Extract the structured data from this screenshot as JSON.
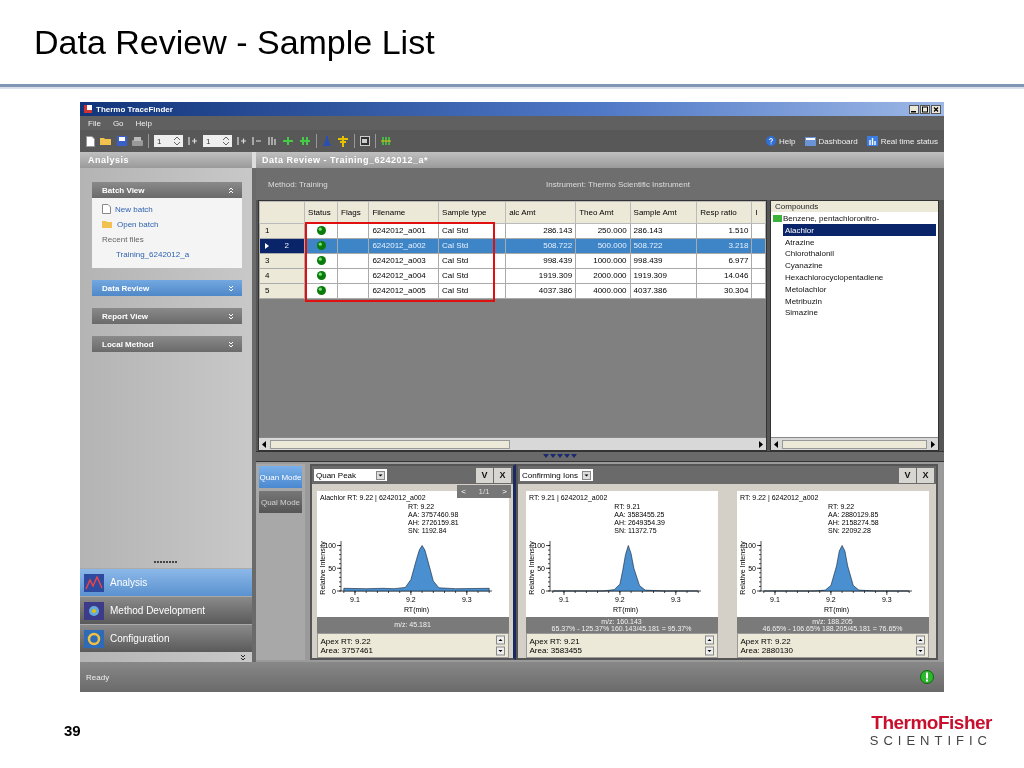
{
  "slide": {
    "title": "Data Review - Sample List",
    "page_number": "39",
    "logo": {
      "name": "ThermoFisher",
      "tagline": "SCIENTIFIC"
    }
  },
  "window": {
    "title": "Thermo TraceFinder"
  },
  "menu": [
    "File",
    "Go",
    "Help"
  ],
  "toolbar": {
    "spinners": [
      "1",
      "1"
    ],
    "links": [
      "Help",
      "Dashboard",
      "Real time status"
    ]
  },
  "sidebar": {
    "title": "Analysis",
    "panels": [
      {
        "title": "Batch View",
        "selected": false,
        "expanded": true,
        "items": [
          {
            "kind": "doc-link",
            "label": "New batch"
          },
          {
            "kind": "folder-link",
            "label": "Open batch"
          },
          {
            "kind": "heading",
            "label": "Recent files"
          },
          {
            "kind": "recent",
            "label": "Training_6242012_a"
          }
        ]
      },
      {
        "title": "Data Review",
        "selected": true,
        "expanded": false
      },
      {
        "title": "Report View",
        "selected": false,
        "expanded": false
      },
      {
        "title": "Local Method",
        "selected": false,
        "expanded": false
      }
    ],
    "nav": [
      {
        "label": "Analysis",
        "selected": true
      },
      {
        "label": "Method Development",
        "selected": false
      },
      {
        "label": "Configuration",
        "selected": false
      }
    ]
  },
  "main": {
    "title": "Data Review - Training_6242012_a*",
    "method": "Method:  Training",
    "instrument": "Instrument:  Thermo Scientific Instrument"
  },
  "table": {
    "columns": [
      "Status",
      "Flags",
      "Filename",
      "Sample type",
      "alc Amt",
      "Theo Amt",
      "Sample Amt",
      "Resp ratio",
      "I"
    ],
    "rows": [
      {
        "number": "1",
        "selected": false,
        "filename": "6242012_a001",
        "sample_type": "Cal Std",
        "calc_amt": "286.143",
        "theo_amt": "250.000",
        "sample_amt": "286.143",
        "resp_ratio": "1.510"
      },
      {
        "number": "2",
        "selected": true,
        "filename": "6242012_a002",
        "sample_type": "Cal Std",
        "calc_amt": "508.722",
        "theo_amt": "500.000",
        "sample_amt": "508.722",
        "resp_ratio": "3.218"
      },
      {
        "number": "3",
        "selected": false,
        "filename": "6242012_a003",
        "sample_type": "Cal Std",
        "calc_amt": "998.439",
        "theo_amt": "1000.000",
        "sample_amt": "998.439",
        "resp_ratio": "6.977"
      },
      {
        "number": "4",
        "selected": false,
        "filename": "6242012_a004",
        "sample_type": "Cal Std",
        "calc_amt": "1919.309",
        "theo_amt": "2000.000",
        "sample_amt": "1919.309",
        "resp_ratio": "14.046"
      },
      {
        "number": "5",
        "selected": false,
        "filename": "6242012_a005",
        "sample_type": "Cal Std",
        "calc_amt": "4037.386",
        "theo_amt": "4000.000",
        "sample_amt": "4037.386",
        "resp_ratio": "30.304"
      }
    ]
  },
  "compounds": {
    "title": "Compounds",
    "tree": [
      {
        "label": "Benzene, pentachloronitro-",
        "selected": false,
        "children": [
          {
            "label": "Alachlor",
            "selected": true
          },
          {
            "label": "Atrazine",
            "selected": false
          },
          {
            "label": "Chlorothalonil",
            "selected": false
          },
          {
            "label": "Cyanazine",
            "selected": false
          },
          {
            "label": "Hexachlorocyclopentadiene",
            "selected": false
          },
          {
            "label": "Metolachlor",
            "selected": false
          },
          {
            "label": "Metribuzin",
            "selected": false
          },
          {
            "label": "Simazine",
            "selected": false
          }
        ]
      }
    ]
  },
  "modes": [
    {
      "label": "Quan Mode",
      "selected": true
    },
    {
      "label": "Qual Mode",
      "selected": false
    }
  ],
  "panes": [
    {
      "dropdown": "Quan Peak",
      "controls": [
        "V",
        "X"
      ],
      "pager": {
        "prev": "<",
        "page": "1/1",
        "next": ">"
      },
      "plots": [
        {
          "title": "Alachlor  RT: 9.22 | 6242012_a002",
          "peak_info": [
            "RT: 9.22",
            "AA: 3757460.98",
            "AH: 2726159.81",
            "SN: 1192.84"
          ],
          "mz": "m/z: 45.181",
          "apex": [
            "Apex RT: 9.22",
            "Area: 3757461"
          ],
          "chart_data": {
            "type": "area",
            "xlabel": "RT(min)",
            "ylabel": "Relative Intensity",
            "x": [
              9.08,
              9.12,
              9.15,
              9.17,
              9.19,
              9.2,
              9.21,
              9.215,
              9.22,
              9.225,
              9.23,
              9.24,
              9.25,
              9.28,
              9.34
            ],
            "series": [
              {
                "color": "#4a8fd0",
                "values": [
                  6,
                  5,
                  6,
                  5,
                  8,
                  25,
                  70,
                  90,
                  100,
                  90,
                  68,
                  22,
                  7,
                  5,
                  6
                ]
              }
            ],
            "xlim": [
              9.075,
              9.345
            ],
            "ylim": [
              0,
              110
            ],
            "xticks": [
              9.1,
              9.2,
              9.3
            ],
            "yticks": [
              0,
              50,
              100
            ]
          }
        }
      ]
    },
    {
      "dropdown": "Confirming Ions",
      "controls": [
        "V",
        "X"
      ],
      "plots": [
        {
          "title": "RT: 9.21 | 6242012_a002",
          "peak_info": [
            "RT: 9.21",
            "AA: 3583455.25",
            "AH: 2649354.39",
            "SN: 11372.75"
          ],
          "mz": "m/z: 160.143",
          "ratio": "65.37% - 125.37% 160.143/45.181 = 95.37%",
          "apex": [
            "Apex RT: 9.21",
            "Area: 3583455"
          ],
          "chart_data": {
            "type": "area",
            "xlabel": "RT(min)",
            "ylabel": "Relative Intensity",
            "x": [
              9.08,
              9.12,
              9.15,
              9.17,
              9.19,
              9.2,
              9.205,
              9.21,
              9.215,
              9.22,
              9.225,
              9.235,
              9.245,
              9.28,
              9.34
            ],
            "series": [
              {
                "color": "#4a8fd0",
                "values": [
                  0,
                  0,
                  0,
                  0,
                  3,
                  15,
                  45,
                  80,
                  100,
                  82,
                  50,
                  12,
                  2,
                  0,
                  0
                ]
              }
            ],
            "xlim": [
              9.075,
              9.345
            ],
            "ylim": [
              0,
              110
            ],
            "xticks": [
              9.1,
              9.2,
              9.3
            ],
            "yticks": [
              0,
              50,
              100
            ]
          }
        },
        {
          "title": "RT: 9.22 | 6242012_a002",
          "peak_info": [
            "RT: 9.22",
            "AA: 2880129.85",
            "AH: 2158274.58",
            "SN: 22092.28"
          ],
          "mz": "m/z: 188.205",
          "ratio": "46.65% - 106.65% 188.205/45.181 = 76.65%",
          "apex": [
            "Apex RT: 9.22",
            "Area: 2880130"
          ],
          "chart_data": {
            "type": "area",
            "xlabel": "RT(min)",
            "ylabel": "Relative Intensity",
            "x": [
              9.08,
              9.12,
              9.15,
              9.17,
              9.19,
              9.2,
              9.21,
              9.215,
              9.22,
              9.225,
              9.23,
              9.24,
              9.25,
              9.28,
              9.34
            ],
            "series": [
              {
                "color": "#4a8fd0",
                "values": [
                  0,
                  0,
                  0,
                  0,
                  2,
                  12,
                  55,
                  88,
                  100,
                  88,
                  55,
                  12,
                  2,
                  0,
                  0
                ]
              }
            ],
            "xlim": [
              9.075,
              9.345
            ],
            "ylim": [
              0,
              110
            ],
            "xticks": [
              9.1,
              9.2,
              9.3
            ],
            "yticks": [
              0,
              50,
              100
            ]
          }
        }
      ]
    }
  ],
  "status_bar": {
    "text": "Ready"
  }
}
